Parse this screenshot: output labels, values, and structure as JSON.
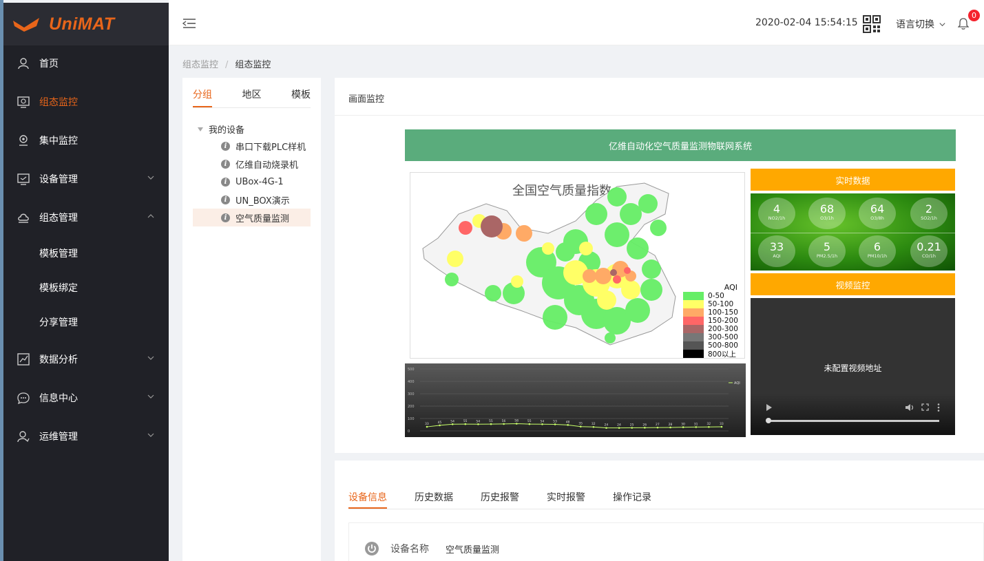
{
  "app": {
    "logo_text": "UniMAT",
    "brand_color": "#e8651a"
  },
  "sidebar": {
    "items": [
      {
        "label": "首页",
        "icon": "user-icon"
      },
      {
        "label": "组态监控",
        "icon": "monitor-icon",
        "active": true
      },
      {
        "label": "集中监控",
        "icon": "location-icon"
      },
      {
        "label": "设备管理",
        "icon": "device-icon"
      },
      {
        "label": "组态管理",
        "icon": "cloud-icon"
      },
      {
        "label": "模板管理"
      },
      {
        "label": "模板绑定"
      },
      {
        "label": "分享管理"
      },
      {
        "label": "数据分析",
        "icon": "chart-icon"
      },
      {
        "label": "信息中心",
        "icon": "message-icon"
      },
      {
        "label": "运维管理",
        "icon": "ops-user-icon"
      }
    ]
  },
  "header": {
    "datetime": "2020-02-04 15:54:15",
    "language_label": "语言切换",
    "notification_count": "0"
  },
  "breadcrumb": {
    "parent": "组态监控",
    "separator": "/",
    "current": "组态监控"
  },
  "tree": {
    "tabs": [
      "分组",
      "地区",
      "模板"
    ],
    "root": "我的设备",
    "leaves": [
      "串口下载PLC样机",
      "亿维自动烧录机",
      "UBox-4G-1",
      "UN_BOX演示",
      "空气质量监测"
    ]
  },
  "monitor": {
    "panel_title": "画面监控",
    "system_title": "亿维自动化空气质量监测物联网系统",
    "map_title": "全国空气质量指数",
    "legend_title": "AQI",
    "legend": [
      {
        "label": "0-50",
        "color": "#66ee66"
      },
      {
        "label": "50-100",
        "color": "#ffff66"
      },
      {
        "label": "100-150",
        "color": "#ffaa66"
      },
      {
        "label": "150-200",
        "color": "#ff6666"
      },
      {
        "label": "200-300",
        "color": "#aa6666"
      },
      {
        "label": "300-500",
        "color": "#777777"
      },
      {
        "label": "500-800",
        "color": "#555555"
      },
      {
        "label": "800以上",
        "color": "#000000"
      }
    ],
    "realtime_title": "实时数据",
    "realtime": [
      {
        "value": "4",
        "name": "NO2/1h"
      },
      {
        "value": "68",
        "name": "O3/1h"
      },
      {
        "value": "64",
        "name": "O3/8h"
      },
      {
        "value": "2",
        "name": "SO2/1h"
      },
      {
        "value": "33",
        "name": "AQI"
      },
      {
        "value": "5",
        "name": "PM2.5/1h"
      },
      {
        "value": "6",
        "name": "PM10/1h"
      },
      {
        "value": "0.21",
        "name": "CO/1h"
      }
    ],
    "video_title": "视频监控",
    "video_message": "未配置视频地址"
  },
  "chart_data": {
    "type": "line",
    "legend": "AQI",
    "ylim": [
      0,
      500
    ],
    "yticks": [
      0,
      100,
      200,
      300,
      400,
      500
    ],
    "series": [
      {
        "name": "AQI",
        "values": [
          33,
          45,
          54,
          55,
          54,
          55,
          56,
          58,
          55,
          54,
          53,
          48,
          35,
          32,
          24,
          24,
          25,
          26,
          27,
          28,
          30,
          31,
          32,
          33
        ]
      }
    ]
  },
  "details": {
    "tabs": [
      "设备信息",
      "历史数据",
      "历史报警",
      "实时报警",
      "操作记录"
    ],
    "device_name_label": "设备名称",
    "device_name_value": "空气质量监测"
  }
}
